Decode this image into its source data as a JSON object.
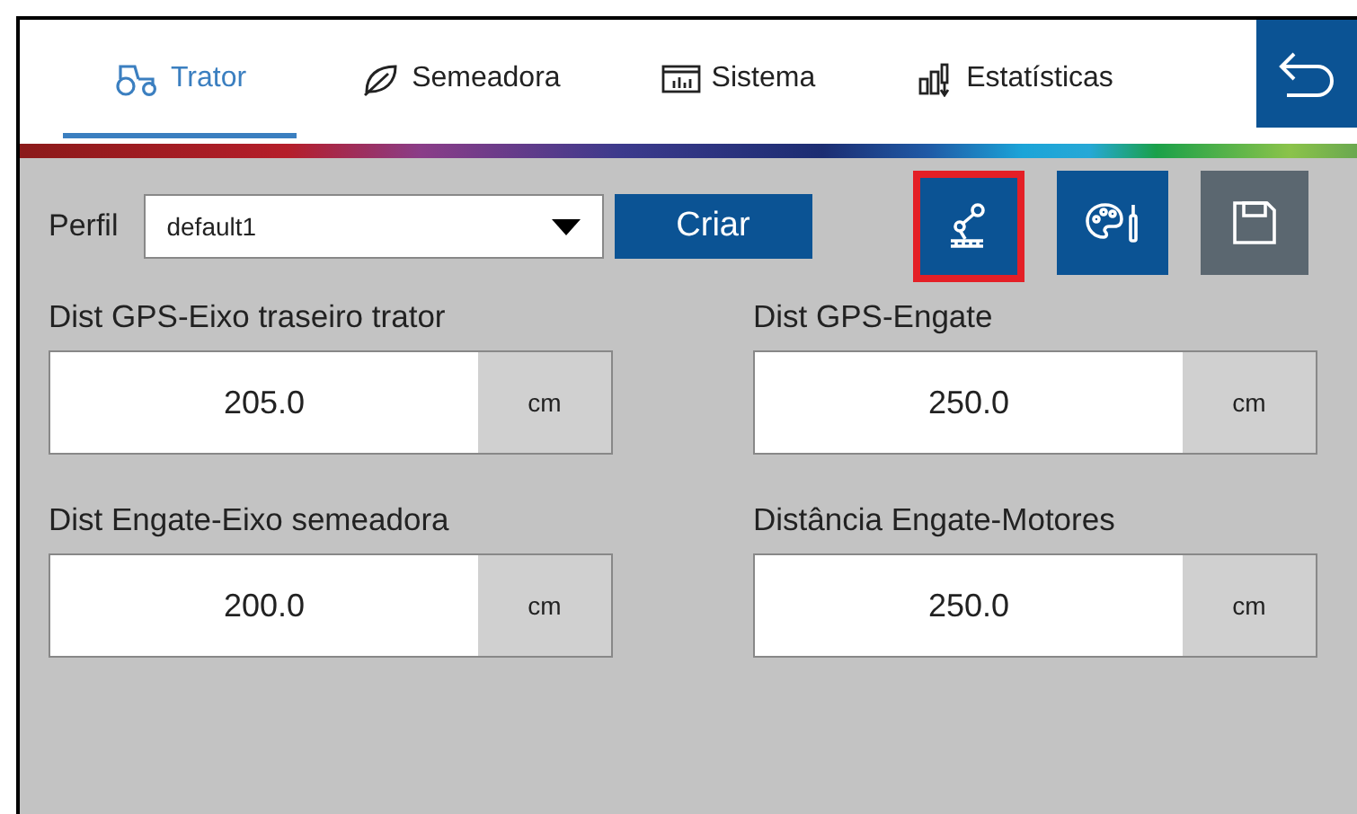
{
  "tabs": [
    {
      "label": "Trator",
      "kind": "tractor",
      "selected": true
    },
    {
      "label": "Semeadora",
      "kind": "leaf",
      "selected": false
    },
    {
      "label": "Sistema",
      "kind": "system",
      "selected": false
    },
    {
      "label": "Estatísticas",
      "kind": "stats",
      "selected": false
    }
  ],
  "profile": {
    "label": "Perfil",
    "value": "default1",
    "button": "Criar"
  },
  "tools": [
    {
      "kind": "robot",
      "selected": true
    },
    {
      "kind": "palette",
      "selected": false
    },
    {
      "kind": "save",
      "selected": false
    }
  ],
  "fields": [
    {
      "label": "Dist GPS-Eixo traseiro trator",
      "value": "205.0",
      "unit": "cm"
    },
    {
      "label": "Dist GPS-Engate",
      "value": "250.0",
      "unit": "cm"
    },
    {
      "label": "Dist Engate-Eixo semeadora",
      "value": "200.0",
      "unit": "cm"
    },
    {
      "label": "Distância Engate-Motores",
      "value": "250.0",
      "unit": "cm"
    }
  ]
}
